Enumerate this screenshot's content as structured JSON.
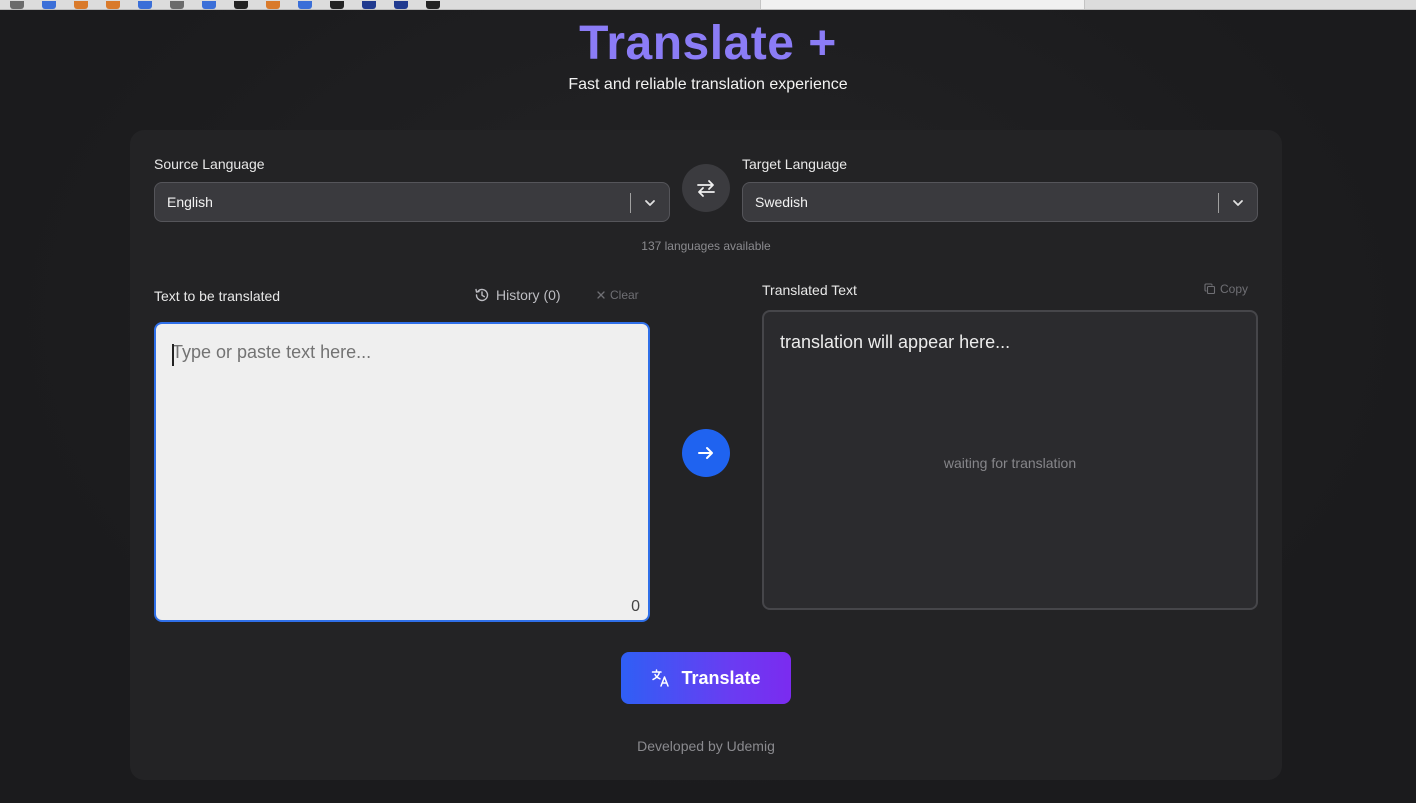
{
  "app": {
    "title": "Translate +",
    "subtitle": "Fast and reliable translation experience",
    "accent_color": "#8b7cf6"
  },
  "source": {
    "label": "Source Language",
    "selected": "English"
  },
  "target": {
    "label": "Target Language",
    "selected": "Swedish"
  },
  "languages_available": "137 languages available",
  "input": {
    "label": "Text to be translated",
    "history_label": "History (0)",
    "clear_label": "Clear",
    "placeholder": "Type or paste text here...",
    "char_count": "0"
  },
  "output": {
    "label": "Translated Text",
    "copy_label": "Copy",
    "placeholder": "translation will appear here...",
    "status": "waiting for translation"
  },
  "translate_button": {
    "label": "Translate"
  },
  "footer": {
    "text": "Developed by Udemig"
  },
  "icons": {
    "swap": "swap-arrows-icon",
    "arrow": "arrow-right-icon",
    "history": "history-icon",
    "clear": "close-icon",
    "copy": "copy-icon",
    "translate": "translate-icon",
    "chevron": "chevron-down-icon"
  },
  "colors": {
    "primary_blue": "#1f63f0",
    "gradient_end": "#7b2bf0"
  }
}
